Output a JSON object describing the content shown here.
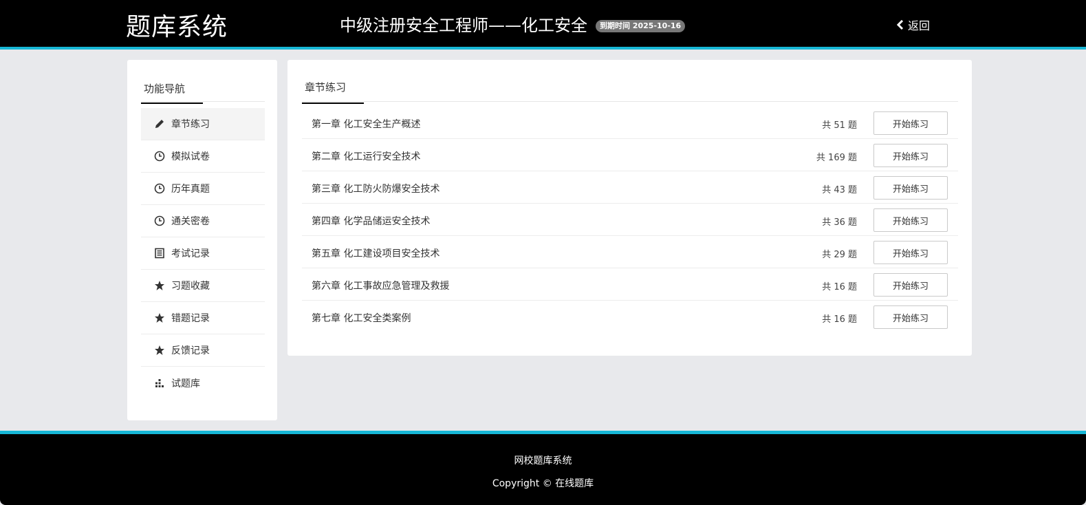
{
  "header": {
    "logo": "题库系统",
    "exam_title": "中级注册安全工程师——化工安全",
    "expire_badge": "到期时间 2025-10-16",
    "back_label": "返回"
  },
  "sidebar": {
    "heading": "功能导航",
    "items": [
      {
        "label": "章节练习",
        "icon": "pencil-icon",
        "active": true
      },
      {
        "label": "模拟试卷",
        "icon": "clock-icon"
      },
      {
        "label": "历年真题",
        "icon": "clock-icon"
      },
      {
        "label": "通关密卷",
        "icon": "clock-icon"
      },
      {
        "label": "考试记录",
        "icon": "list-alt-icon"
      },
      {
        "label": "习题收藏",
        "icon": "star-icon"
      },
      {
        "label": "错题记录",
        "icon": "star-icon"
      },
      {
        "label": "反馈记录",
        "icon": "star-icon"
      },
      {
        "label": "试题库",
        "icon": "bar-chart-icon"
      }
    ]
  },
  "main": {
    "tab": "章节练习",
    "chapters": [
      {
        "title": "第一章 化工安全生产概述",
        "count": "共 51 题",
        "button": "开始练习"
      },
      {
        "title": "第二章 化工运行安全技术",
        "count": "共 169 题",
        "button": "开始练习"
      },
      {
        "title": "第三章 化工防火防爆安全技术",
        "count": "共 43 题",
        "button": "开始练习"
      },
      {
        "title": "第四章 化学品储运安全技术",
        "count": "共 36 题",
        "button": "开始练习"
      },
      {
        "title": "第五章 化工建设项目安全技术",
        "count": "共 29 题",
        "button": "开始练习"
      },
      {
        "title": "第六章 化工事故应急管理及救援",
        "count": "共 16 题",
        "button": "开始练习"
      },
      {
        "title": "第七章 化工安全类案例",
        "count": "共 16 题",
        "button": "开始练习"
      }
    ]
  },
  "footer": {
    "line1": "网校题库系统",
    "line2": "Copyright © 在线题库"
  },
  "colors": {
    "accent": "#17b7d6",
    "header_bg": "#000000",
    "page_bg": "#e8e9ec",
    "badge_bg": "#777777"
  }
}
